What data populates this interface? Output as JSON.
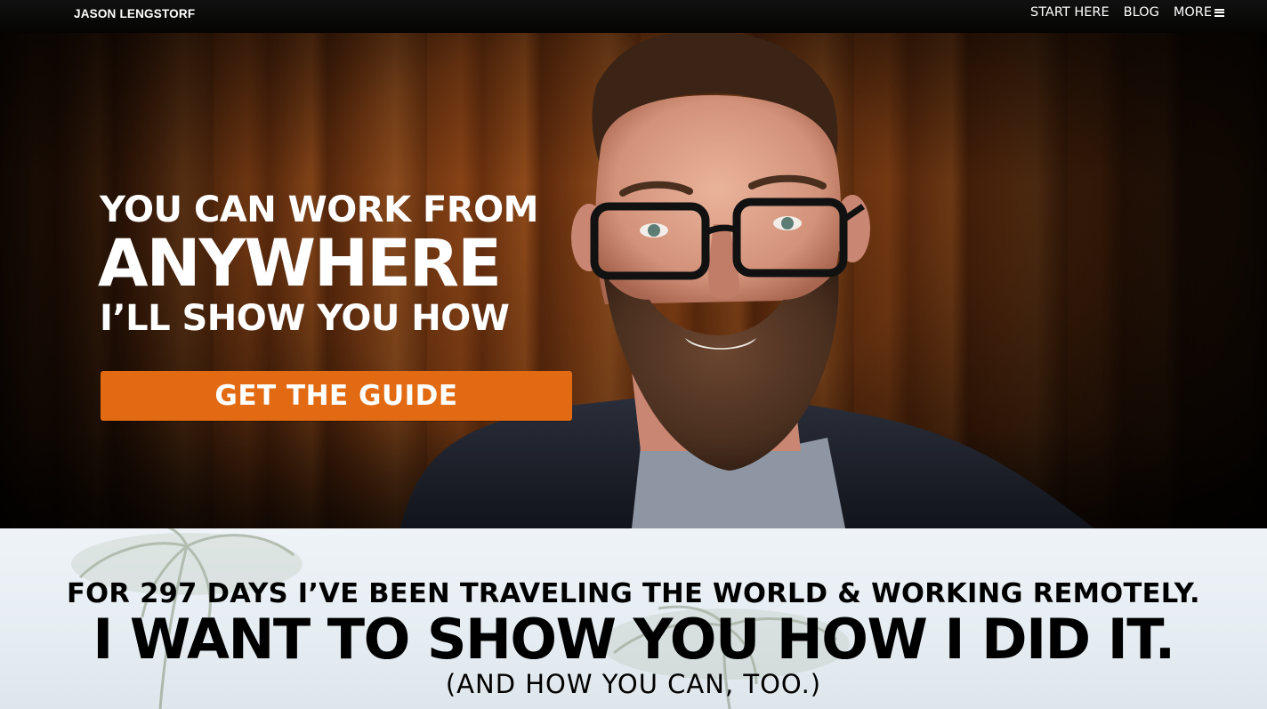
{
  "nav": {
    "brand": "JASON LENGSTORF",
    "links": [
      "START HERE",
      "BLOG"
    ],
    "more_label": "MORE",
    "more_icon": "hamburger-icon"
  },
  "hero": {
    "headline_line1": "YOU CAN WORK FROM",
    "headline_line2": "ANYWHERE",
    "headline_line3": "I’LL SHOW YOU HOW",
    "cta_label": "GET THE GUIDE",
    "cta_color": "#e16a12"
  },
  "banner": {
    "line1": "FOR 297 DAYS I’VE BEEN TRAVELING THE WORLD & WORKING REMOTELY.",
    "line2": "I WANT TO SHOW YOU HOW I DID IT.",
    "line3": "(AND HOW YOU CAN, TOO.)"
  }
}
